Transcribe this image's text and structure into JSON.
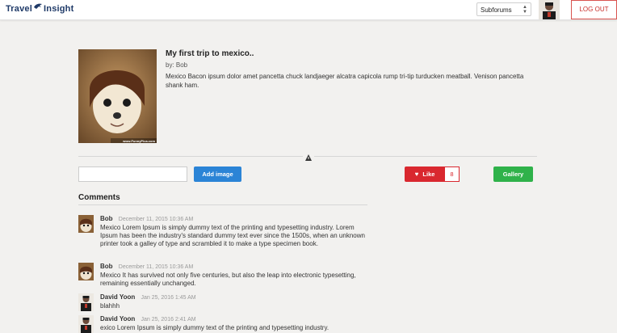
{
  "header": {
    "logo_text_left": "Travel",
    "logo_text_right": "Insight",
    "subforums_label": "Subforums",
    "logout_label": "LOG OUT"
  },
  "post": {
    "title": "My first trip to mexico..",
    "author": "by: Bob",
    "body": "Mexico Bacon ipsum dolor amet pancetta chuck landjaeger alcatra capicola rump tri-tip turducken meatball. Venison pancetta shank ham.",
    "image_watermark": "www.FunnyPica.com"
  },
  "actions": {
    "add_image_label": "Add image",
    "like_label": "Like",
    "like_count": "8",
    "gallery_label": "Gallery"
  },
  "comments": {
    "heading": "Comments",
    "items": [
      {
        "author": "Bob",
        "date": "December 11, 2015 10:36 AM",
        "text": "Mexico Lorem Ipsum is simply dummy text of the printing and typesetting industry. Lorem Ipsum has been the industry's standard dummy text ever since the 1500s, when an unknown printer took a galley of type and scrambled it to make a type specimen book."
      },
      {
        "author": "Bob",
        "date": "December 11, 2015 10:36 AM",
        "text": "Mexico It has survived not only five centuries, but also the leap into electronic typesetting, remaining essentially unchanged."
      },
      {
        "author": "David Yoon",
        "date": "Jan 25, 2016 1:45 AM",
        "text": "blahhh"
      },
      {
        "author": "David Yoon",
        "date": "Jan 25, 2016 2:41 AM",
        "text": "exico Lorem Ipsum is simply dummy text of the printing and typesetting industry."
      }
    ]
  }
}
